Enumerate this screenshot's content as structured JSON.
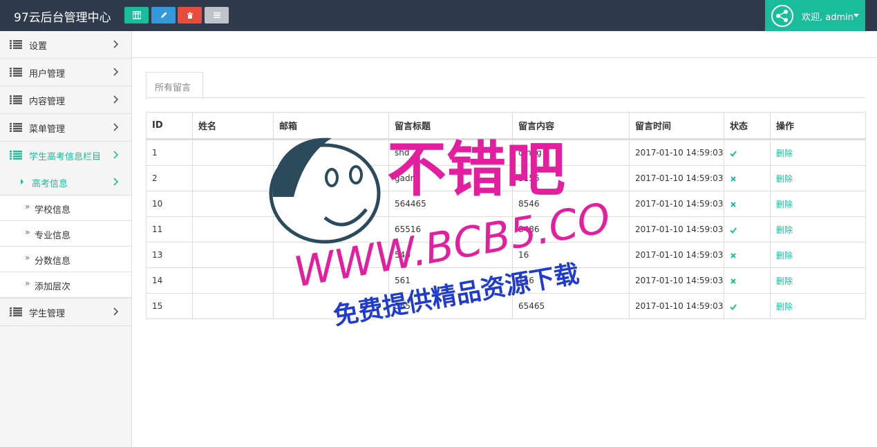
{
  "header": {
    "title": "97云后台管理中心",
    "buttons": [
      {
        "icon": "table-icon",
        "color": "#1abc9c"
      },
      {
        "icon": "pencil-icon",
        "color": "#3498db"
      },
      {
        "icon": "trash-icon",
        "color": "#e74c3c"
      },
      {
        "icon": "list-icon",
        "color": "#bdc3c7"
      }
    ],
    "user_label": "欢迎, admin"
  },
  "sidebar": {
    "items": [
      {
        "label": "设置"
      },
      {
        "label": "用户管理"
      },
      {
        "label": "内容管理"
      },
      {
        "label": "菜单管理"
      },
      {
        "label": "学生高考信息栏目",
        "active": true
      },
      {
        "label": "学生管理"
      }
    ],
    "sub_header": "高考信息",
    "sub_items": [
      {
        "label": "学校信息"
      },
      {
        "label": "专业信息"
      },
      {
        "label": "分数信息"
      },
      {
        "label": "添加层次"
      }
    ]
  },
  "main": {
    "tab_label": "所有留言",
    "table": {
      "headers": [
        "ID",
        "姓名",
        "邮箱",
        "留言标题",
        "留言内容",
        "留言时间",
        "状态",
        "操作"
      ],
      "rows": [
        {
          "id": "1",
          "name": "",
          "email": "",
          "title": "shd",
          "content": "dlhdg",
          "time": "2017-01-10 14:59:03",
          "status": "ok",
          "action": "删除"
        },
        {
          "id": "2",
          "name": "",
          "email": "",
          "title": "gadrg",
          "content": "5156",
          "time": "2017-01-10 14:59:03",
          "status": "no",
          "action": "删除"
        },
        {
          "id": "10",
          "name": "",
          "email": "",
          "title": "564465",
          "content": "8546",
          "time": "2017-01-10 14:59:03",
          "status": "no",
          "action": "删除"
        },
        {
          "id": "11",
          "name": "",
          "email": "",
          "title": "65516",
          "content": "8486",
          "time": "2017-01-10 14:59:03",
          "status": "ok",
          "action": "删除"
        },
        {
          "id": "13",
          "name": "",
          "email": "",
          "title": "546",
          "content": "16",
          "time": "2017-01-10 14:59:03",
          "status": "no",
          "action": "删除"
        },
        {
          "id": "14",
          "name": "",
          "email": "",
          "title": "561",
          "content": "156",
          "time": "2017-01-10 14:59:03",
          "status": "no",
          "action": "删除"
        },
        {
          "id": "15",
          "name": "",
          "email": "",
          "title": "565",
          "content": "65465",
          "time": "2017-01-10 14:59:03",
          "status": "ok",
          "action": "删除"
        }
      ]
    }
  },
  "colors": {
    "accent": "#1abc9c",
    "topbar": "#2f3b4c",
    "ok": "#1abc9c",
    "no": "#1abc9c"
  },
  "watermark": {
    "line1": "不错吧",
    "line2": "WWW.BCB5.COM",
    "line3": "免费提供精品资源下载"
  }
}
